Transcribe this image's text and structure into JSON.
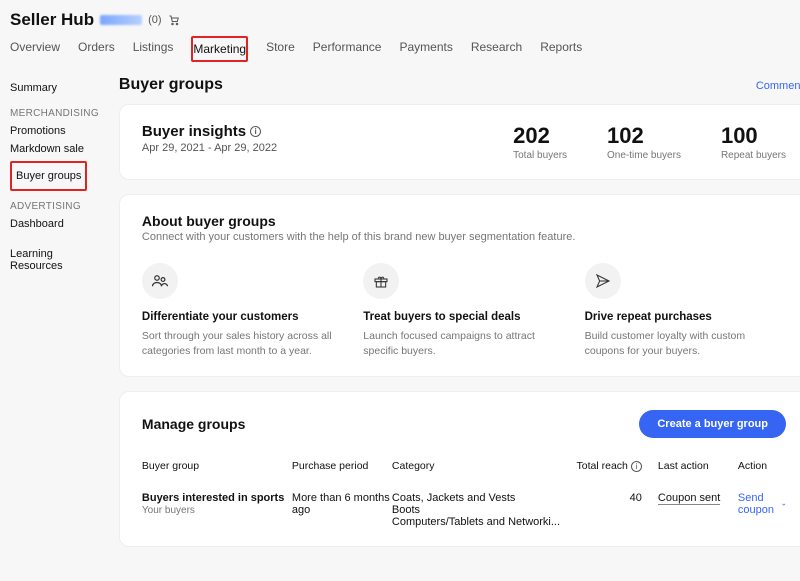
{
  "header": {
    "title": "Seller Hub",
    "count": "(0)"
  },
  "tabs": [
    "Overview",
    "Orders",
    "Listings",
    "Marketing",
    "Store",
    "Performance",
    "Payments",
    "Research",
    "Reports"
  ],
  "sidebar": {
    "summary": "Summary",
    "merchandising_h": "MERCHANDISING",
    "merch_items": [
      "Promotions",
      "Markdown sale",
      "Buyer groups"
    ],
    "advertising_h": "ADVERTISING",
    "adv_items": [
      "Dashboard"
    ],
    "learning": "Learning Resources"
  },
  "page": {
    "title": "Buyer groups",
    "comments": "Comments"
  },
  "insights": {
    "title": "Buyer insights",
    "date": "Apr 29, 2021 - Apr 29, 2022",
    "stats": [
      {
        "num": "202",
        "lab": "Total buyers"
      },
      {
        "num": "102",
        "lab": "One-time buyers"
      },
      {
        "num": "100",
        "lab": "Repeat buyers"
      }
    ]
  },
  "about": {
    "title": "About buyer groups",
    "sub": "Connect with your customers with the help of this brand new buyer segmentation feature.",
    "features": [
      {
        "h": "Differentiate your customers",
        "p": "Sort through your sales history across all categories from last month to a year."
      },
      {
        "h": "Treat buyers to special deals",
        "p": "Launch focused campaigns to attract specific buyers."
      },
      {
        "h": "Drive repeat purchases",
        "p": "Build customer loyalty with custom coupons for your buyers."
      }
    ]
  },
  "manage": {
    "title": "Manage groups",
    "create_btn": "Create a buyer group",
    "cols": {
      "group": "Buyer group",
      "period": "Purchase period",
      "cat": "Category",
      "reach": "Total reach",
      "last": "Last action",
      "action": "Action"
    },
    "row": {
      "name": "Buyers interested in sports",
      "sub": "Your buyers",
      "period": "More than 6 months ago",
      "cat": "Coats, Jackets and Vests\nBoots\nComputers/Tablets and Networki...",
      "reach": "40",
      "last": "Coupon sent",
      "action": "Send coupon"
    }
  }
}
